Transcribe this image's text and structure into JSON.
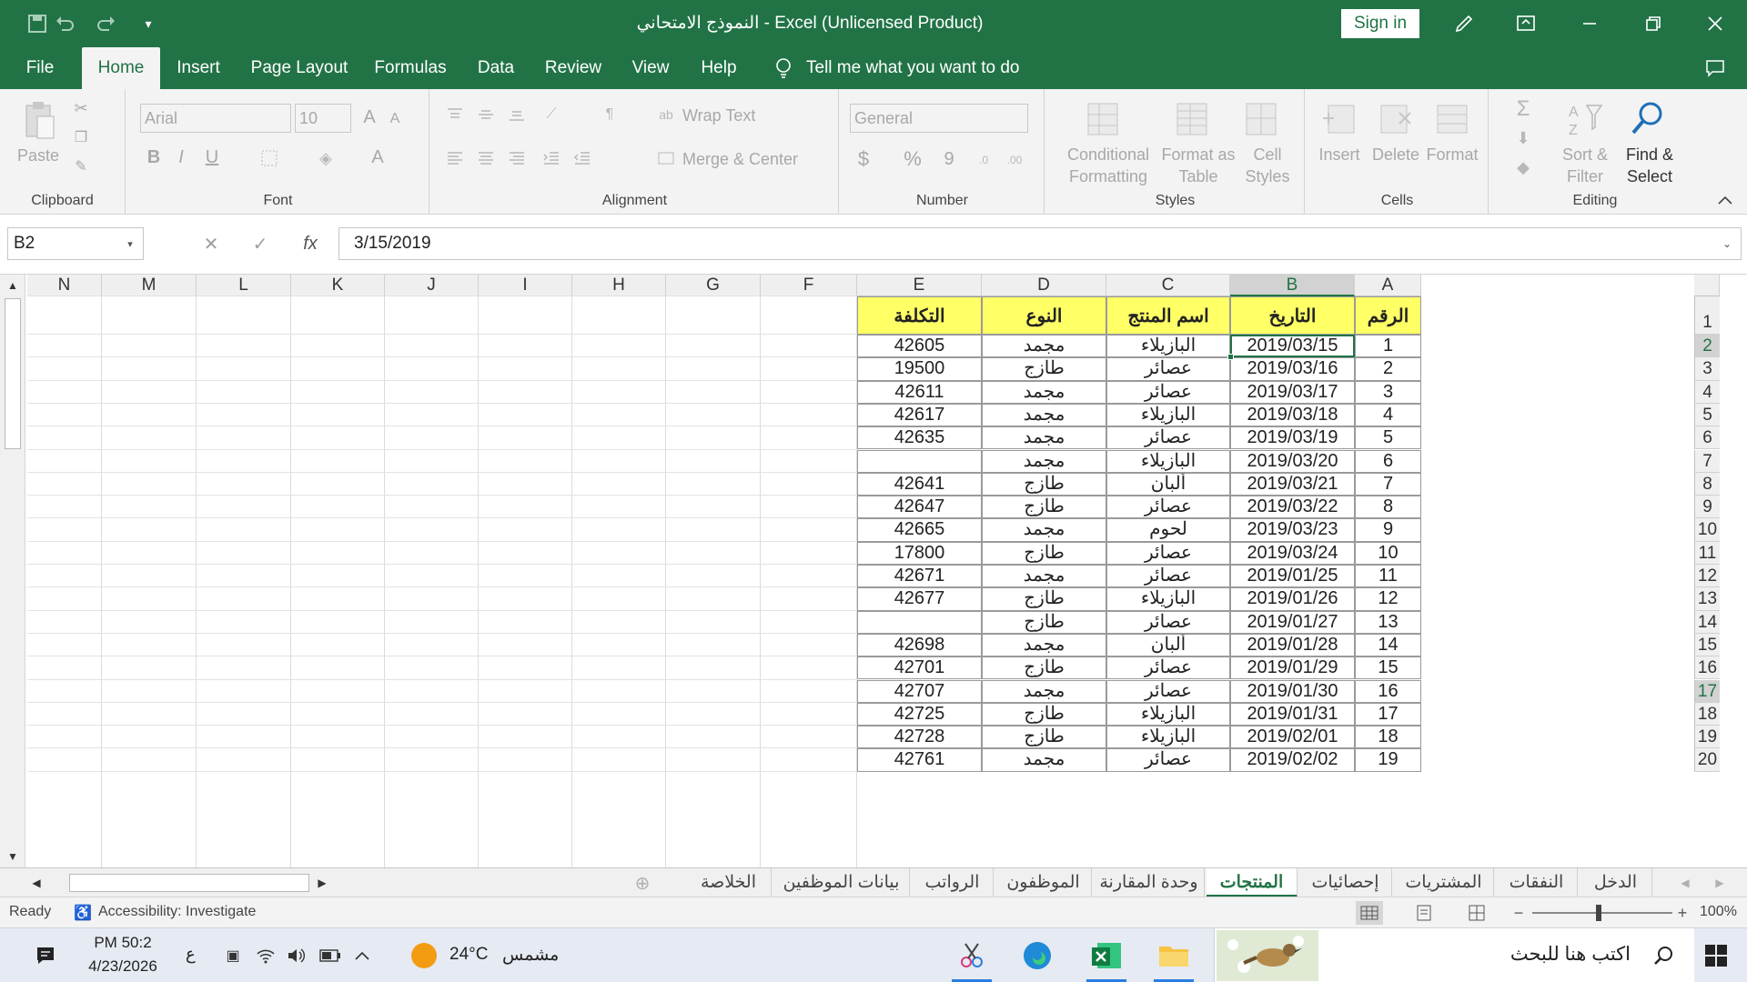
{
  "titlebar": {
    "title": "النموذج الامتحاني  -  Excel (Unlicensed Product)",
    "sign_in": "Sign in"
  },
  "menu_tabs": [
    "File",
    "Home",
    "Insert",
    "Page Layout",
    "Formulas",
    "Data",
    "Review",
    "View",
    "Help"
  ],
  "tell_me": "Tell me what you want to do",
  "ribbon": {
    "clipboard": {
      "label": "Clipboard",
      "paste": "Paste"
    },
    "font": {
      "label": "Font",
      "name": "Arial",
      "size": "10",
      "bold": "B",
      "italic": "I",
      "underline": "U",
      "a_up": "A",
      "a_down": "A",
      "font_color": "A"
    },
    "alignment": {
      "label": "Alignment",
      "wrap": "Wrap Text",
      "merge": "Merge & Center"
    },
    "number": {
      "label": "Number",
      "format": "General",
      "currency": "$",
      "percent": "%",
      "comma": "9"
    },
    "styles": {
      "label": "Styles",
      "cond1": "Conditional",
      "cond2": "Formatting",
      "fmt1": "Format as",
      "fmt2": "Table",
      "cs1": "Cell",
      "cs2": "Styles"
    },
    "cells": {
      "label": "Cells",
      "insert": "Insert",
      "delete": "Delete",
      "format": "Format"
    },
    "editing": {
      "label": "Editing",
      "sort1": "Sort &",
      "sort2": "Filter",
      "find1": "Find &",
      "find2": "Select"
    }
  },
  "formula_bar": {
    "name_box": "B2",
    "formula": "3/15/2019",
    "fx": "fx"
  },
  "columns": [
    "N",
    "M",
    "L",
    "K",
    "J",
    "I",
    "H",
    "G",
    "F",
    "E",
    "D",
    "C",
    "B",
    "A"
  ],
  "headers": {
    "cost": "التكلفة",
    "type": "النوع",
    "product": "اسم المنتج",
    "date": "التاريخ",
    "num": "الرقم"
  },
  "rows": [
    {
      "n": "1",
      "date": "2019/03/15",
      "product": "البازيلاء",
      "type": "مجمد",
      "cost": "42605"
    },
    {
      "n": "2",
      "date": "2019/03/16",
      "product": "عصائر",
      "type": "طازج",
      "cost": "19500"
    },
    {
      "n": "3",
      "date": "2019/03/17",
      "product": "عصائر",
      "type": "مجمد",
      "cost": "42611"
    },
    {
      "n": "4",
      "date": "2019/03/18",
      "product": "البازيلاء",
      "type": "مجمد",
      "cost": "42617"
    },
    {
      "n": "5",
      "date": "2019/03/19",
      "product": "عصائر",
      "type": "مجمد",
      "cost": "42635"
    },
    {
      "n": "6",
      "date": "2019/03/20",
      "product": "البازيلاء",
      "type": "مجمد",
      "cost": ""
    },
    {
      "n": "7",
      "date": "2019/03/21",
      "product": "ألبان",
      "type": "طازج",
      "cost": "42641"
    },
    {
      "n": "8",
      "date": "2019/03/22",
      "product": "عصائر",
      "type": "طازج",
      "cost": "42647"
    },
    {
      "n": "9",
      "date": "2019/03/23",
      "product": "لحوم",
      "type": "مجمد",
      "cost": "42665"
    },
    {
      "n": "10",
      "date": "2019/03/24",
      "product": "عصائر",
      "type": "طازج",
      "cost": "17800"
    },
    {
      "n": "11",
      "date": "2019/01/25",
      "product": "عصائر",
      "type": "مجمد",
      "cost": "42671"
    },
    {
      "n": "12",
      "date": "2019/01/26",
      "product": "البازيلاء",
      "type": "طازج",
      "cost": "42677"
    },
    {
      "n": "13",
      "date": "2019/01/27",
      "product": "عصائر",
      "type": "طازج",
      "cost": ""
    },
    {
      "n": "14",
      "date": "2019/01/28",
      "product": "ألبان",
      "type": "مجمد",
      "cost": "42698"
    },
    {
      "n": "15",
      "date": "2019/01/29",
      "product": "عصائر",
      "type": "طازج",
      "cost": "42701"
    },
    {
      "n": "16",
      "date": "2019/01/30",
      "product": "عصائر",
      "type": "مجمد",
      "cost": "42707"
    },
    {
      "n": "17",
      "date": "2019/01/31",
      "product": "البازيلاء",
      "type": "طازج",
      "cost": "42725"
    },
    {
      "n": "18",
      "date": "2019/02/01",
      "product": "البازيلاء",
      "type": "طازج",
      "cost": "42728"
    },
    {
      "n": "19",
      "date": "2019/02/02",
      "product": "عصائر",
      "type": "مجمد",
      "cost": "42761"
    }
  ],
  "row_numbers": [
    "1",
    "2",
    "3",
    "4",
    "5",
    "6",
    "7",
    "8",
    "9",
    "10",
    "11",
    "12",
    "13",
    "14",
    "15",
    "16",
    "17",
    "18",
    "19",
    "20"
  ],
  "sheet_tabs": [
    "الخلاصة",
    "بيانات الموظفين",
    "الرواتب",
    "الموظفون",
    "وحدة المقارنة",
    "المنتجات",
    "إحصائيات",
    "المشتريات",
    "النفقات",
    "الدخل"
  ],
  "active_sheet": "المنتجات",
  "status": {
    "ready": "Ready",
    "accessibility": "Accessibility: Investigate",
    "zoom": "100%"
  },
  "taskbar": {
    "time": "PM 50:2",
    "date": "4/23/2026",
    "lang": "ع",
    "temp": "24°C",
    "weather": "مشمس",
    "search": "اكتب هنا للبحث"
  },
  "colors": {
    "excel_green": "#217346",
    "header_fill": "#ffff66"
  }
}
